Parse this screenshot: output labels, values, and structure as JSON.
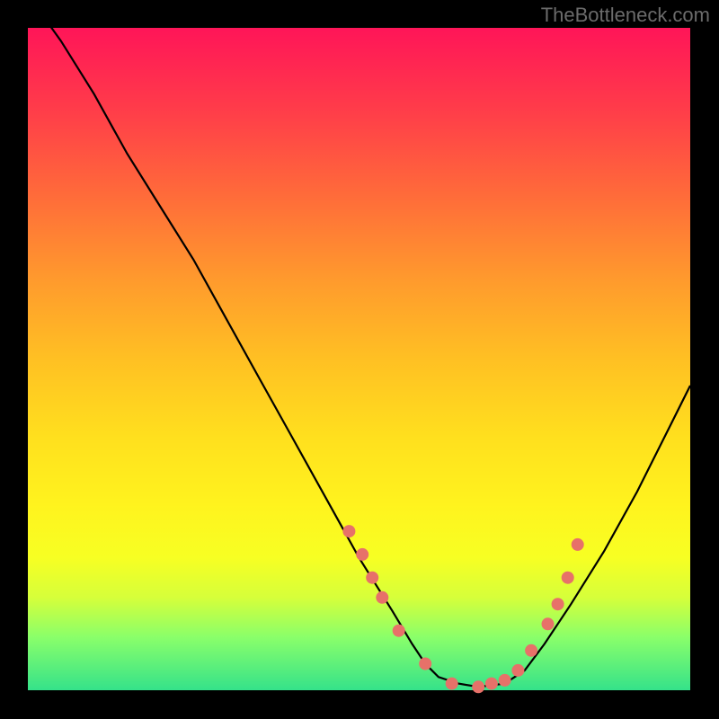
{
  "watermark": "TheBottleneck.com",
  "chart_data": {
    "type": "line",
    "title": "",
    "xlabel": "",
    "ylabel": "",
    "xlim": [
      0,
      100
    ],
    "ylim": [
      0,
      100
    ],
    "curve": {
      "x": [
        0,
        5,
        10,
        15,
        20,
        25,
        30,
        35,
        40,
        45,
        50,
        55,
        58,
        60,
        62,
        65,
        68,
        72,
        75,
        78,
        82,
        87,
        92,
        97,
        100
      ],
      "y": [
        105,
        98,
        90,
        81,
        73,
        65,
        56,
        47,
        38,
        29,
        20,
        12,
        7,
        4,
        2,
        1,
        0.5,
        1,
        3,
        7,
        13,
        21,
        30,
        40,
        46
      ]
    },
    "dots": {
      "x": [
        48.5,
        50.5,
        52,
        53.5,
        56,
        60,
        64,
        68,
        70,
        72,
        74,
        76,
        78.5,
        80,
        81.5,
        83
      ],
      "y": [
        24,
        20.5,
        17,
        14,
        9,
        4,
        1,
        0.5,
        1,
        1.5,
        3,
        6,
        10,
        13,
        17,
        22
      ]
    }
  }
}
